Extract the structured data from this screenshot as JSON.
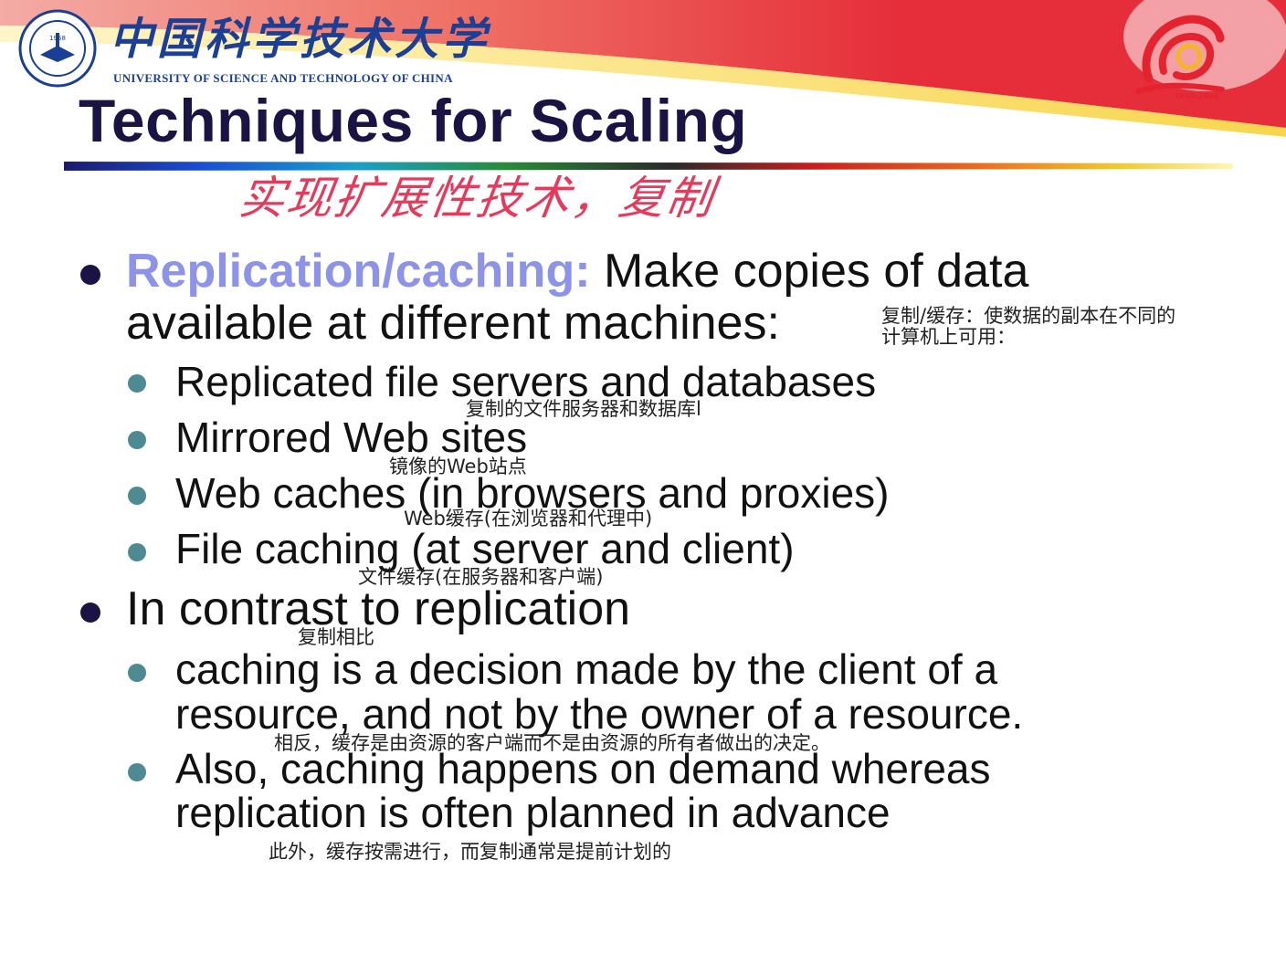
{
  "header": {
    "university_cn": "中国科学技术大学",
    "university_en": "UNIVERSITY OF SCIENCE AND TECHNOLOGY OF CHINA",
    "seal_year": "1958",
    "anniversary_years": "1958–2008",
    "colors": {
      "brand_blue": "#1c3f96",
      "banner_red": "#e4232f",
      "banner_yellow": "#f6d13a"
    }
  },
  "slide": {
    "title": "Techniques for Scaling",
    "handwritten_note": "实现扩展性技术，复制",
    "bullets": [
      {
        "keyword": "Replication/caching:",
        "line1_rest": " Make copies of data",
        "line2": "available at different machines:",
        "note_line1": "复制/缓存：使数据的副本在不同的",
        "note_line2": "计算机上可用：",
        "subs": [
          {
            "text": "Replicated file servers and databases",
            "note": "复制的文件服务器和数据库l"
          },
          {
            "text": "Mirrored Web sites",
            "note": "镜像的Web站点"
          },
          {
            "text": "Web caches (in browsers and proxies)",
            "note": "Web缓存(在浏览器和代理中)"
          },
          {
            "text": "File caching (at server and client)",
            "note": "文件缓存(在服务器和客户端)"
          }
        ]
      },
      {
        "text": "In contrast to replication",
        "note": "复制相比",
        "subs": [
          {
            "line1": "caching is a decision made by the client of a",
            "line2": "resource, and not by the owner of a resource.",
            "note": "相反，缓存是由资源的客户端而不是由资源的所有者做出的决定。"
          },
          {
            "line1": "Also, caching happens on demand whereas",
            "line2": "replication is often planned in advance",
            "note": "此外，缓存按需进行，而复制通常是提前计划的"
          }
        ]
      }
    ]
  }
}
